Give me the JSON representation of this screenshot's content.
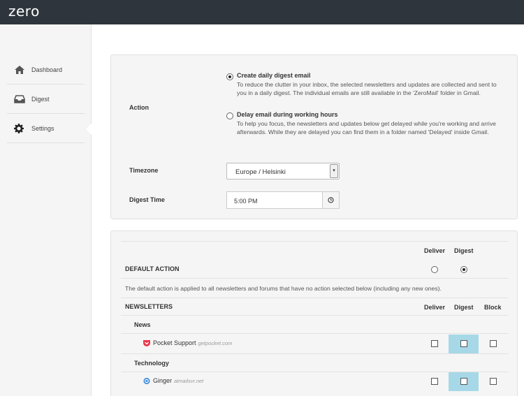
{
  "app": {
    "logo": "zero"
  },
  "sidebar": {
    "items": [
      {
        "label": "Dashboard",
        "icon": "home-icon"
      },
      {
        "label": "Digest",
        "icon": "inbox-icon"
      },
      {
        "label": "Settings",
        "icon": "gear-icon",
        "active": true
      }
    ]
  },
  "settings": {
    "action": {
      "label": "Action",
      "options": [
        {
          "title": "Create daily digest email",
          "desc": "To reduce the clutter in your inbox, the selected newsletters and updates are collected and sent to you in a daily digest. The individual emails are still available in the 'ZeroMail' folder in Gmail.",
          "selected": true
        },
        {
          "title": "Delay email during working hours",
          "desc": "To help you focus, the newsletters and updates below get delayed while you're working and arrive afterwards. While they are delayed you can find them in a folder named 'Delayed' inside Gmail.",
          "selected": false
        }
      ]
    },
    "timezone": {
      "label": "Timezone",
      "value": "Europe / Helsinki"
    },
    "digest_time": {
      "label": "Digest Time",
      "value": "5:00 PM"
    }
  },
  "rules": {
    "columns": {
      "deliver": "Deliver",
      "digest": "Digest",
      "block": "Block"
    },
    "default_action": {
      "title": "DEFAULT ACTION",
      "selected": "Digest",
      "desc": "The default action is applied to all newsletters and forums that have no action selected below (including any new ones)."
    },
    "newsletters": {
      "title": "NEWSLETTERS",
      "groups": [
        {
          "name": "News",
          "items": [
            {
              "name": "Pocket Support",
              "domain": "getpocket.com",
              "icon_color": "#e8374a"
            }
          ]
        },
        {
          "name": "Technology",
          "items": [
            {
              "name": "Ginger",
              "domain": "atmailsvr.net",
              "icon_color": "#4a90d9"
            }
          ]
        }
      ]
    }
  },
  "colors": {
    "topbar": "#2e353c",
    "digest_highlight": "#a6d8e8"
  }
}
